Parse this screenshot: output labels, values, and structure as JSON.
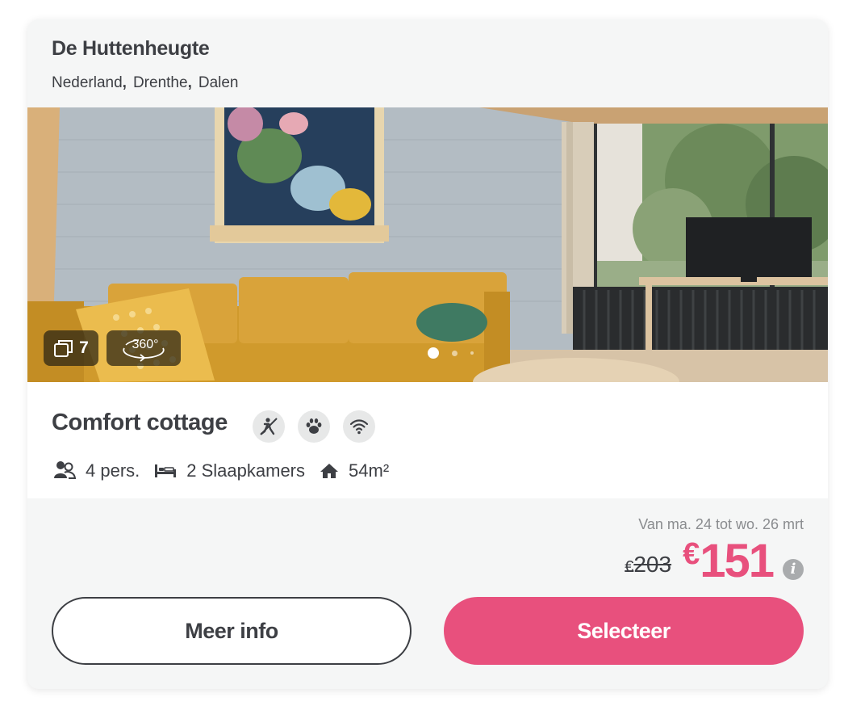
{
  "park": {
    "name": "De Huttenheugte",
    "location": [
      "Nederland",
      "Drenthe",
      "Dalen"
    ]
  },
  "gallery": {
    "photo_count": "7",
    "tour_label": "360°",
    "slide_index": 1,
    "slide_total": 3
  },
  "accommodation": {
    "type": "Comfort cottage",
    "features": [
      "non-smoking-icon",
      "pets-allowed-icon",
      "wifi-icon"
    ],
    "persons": "4 pers.",
    "bedrooms": "2 Slaapkamers",
    "area": "54m²"
  },
  "pricing": {
    "period": "Van ma. 24 tot wo. 26 mrt",
    "currency": "€",
    "old_price": "203",
    "new_price": "151"
  },
  "buttons": {
    "more_info": "Meer info",
    "select": "Selecteer"
  },
  "colors": {
    "accent": "#e8507d",
    "text": "#3d3f44",
    "muted": "#8a8c8f",
    "card_bg": "#f5f6f6"
  }
}
